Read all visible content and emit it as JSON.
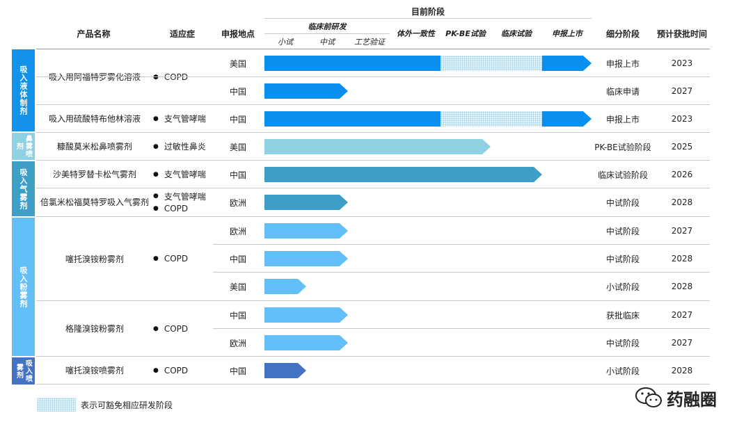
{
  "header": {
    "current_stage": "目前阶段",
    "preclinical": "临床前研发",
    "product": "产品名称",
    "indication": "适应症",
    "location": "申报地点",
    "substage": "细分阶段",
    "approval": "预计获批时间",
    "stages": [
      "小试",
      "中试",
      "工艺验证",
      "体外一致性",
      "PK-BE试验",
      "临床试验",
      "申报上市"
    ]
  },
  "categories": [
    "吸入液体制剂",
    "鼻雾喷剂",
    "吸入气雾剂",
    "吸入粉雾剂",
    "吸入喷雾剂"
  ],
  "products": [
    {
      "name": "吸入用阿福特罗雾化溶液",
      "indications": [
        "COPD"
      ]
    },
    {
      "name": "吸入用硫酸特布他林溶液",
      "indications": [
        "支气管哮喘"
      ]
    },
    {
      "name": "糠酸莫米松鼻喷雾剂",
      "indications": [
        "过敏性鼻炎"
      ]
    },
    {
      "name": "沙美特罗替卡松气雾剂",
      "indications": [
        "支气管哮喘"
      ]
    },
    {
      "name": "倍氯米松福莫特罗吸入气雾剂",
      "indications": [
        "支气管哮喘",
        "COPD"
      ]
    },
    {
      "name": "噻托溴铵粉雾剂",
      "indications": [
        "COPD"
      ]
    },
    {
      "name": "格隆溴铵粉雾剂",
      "indications": [
        "COPD"
      ]
    },
    {
      "name": "噻托溴铵喷雾剂",
      "indications": [
        "COPD"
      ]
    }
  ],
  "rows": [
    {
      "location": "美国",
      "substage": "申报上市",
      "year": "2023",
      "progress_stage": 7,
      "exempt_stages": [
        4,
        5
      ],
      "color": "#0a8ef0"
    },
    {
      "location": "中国",
      "substage": "临床申请",
      "year": "2027",
      "progress_stage": 2,
      "exempt_stages": [],
      "color": "#0a8ef0"
    },
    {
      "location": "中国",
      "substage": "申报上市",
      "year": "2023",
      "progress_stage": 7,
      "exempt_stages": [
        4,
        5
      ],
      "color": "#0a8ef0"
    },
    {
      "location": "美国",
      "substage": "PK-BE试验阶段",
      "year": "2025",
      "progress_stage": 5,
      "exempt_stages": [],
      "color": "#8fd1e2"
    },
    {
      "location": "中国",
      "substage": "临床试验阶段",
      "year": "2026",
      "progress_stage": 6,
      "exempt_stages": [],
      "color": "#3d9ec6"
    },
    {
      "location": "欧洲",
      "substage": "中试阶段",
      "year": "2028",
      "progress_stage": 2,
      "exempt_stages": [],
      "color": "#3d9ec6"
    },
    {
      "location": "欧洲",
      "substage": "中试阶段",
      "year": "2027",
      "progress_stage": 2,
      "exempt_stages": [],
      "color": "#63bff8"
    },
    {
      "location": "中国",
      "substage": "中试阶段",
      "year": "2028",
      "progress_stage": 2,
      "exempt_stages": [],
      "color": "#63bff8"
    },
    {
      "location": "美国",
      "substage": "小试阶段",
      "year": "2028",
      "progress_stage": 1,
      "exempt_stages": [],
      "color": "#63bff8"
    },
    {
      "location": "中国",
      "substage": "获批临床",
      "year": "2027",
      "progress_stage": 2,
      "exempt_stages": [],
      "color": "#63bff8"
    },
    {
      "location": "欧洲",
      "substage": "中试阶段",
      "year": "2027",
      "progress_stage": 2,
      "exempt_stages": [],
      "color": "#63bff8"
    },
    {
      "location": "中国",
      "substage": "小试阶段",
      "year": "2028",
      "progress_stage": 1,
      "exempt_stages": [],
      "color": "#4472c4"
    }
  ],
  "category_colors": [
    "#1292e8",
    "#8fd1e2",
    "#3d9ec6",
    "#63bff8",
    "#4472c4"
  ],
  "legend": {
    "text": "表示可豁免相应研发阶段"
  },
  "watermark": {
    "text": "药融圈",
    "icon": "wechat-icon"
  }
}
